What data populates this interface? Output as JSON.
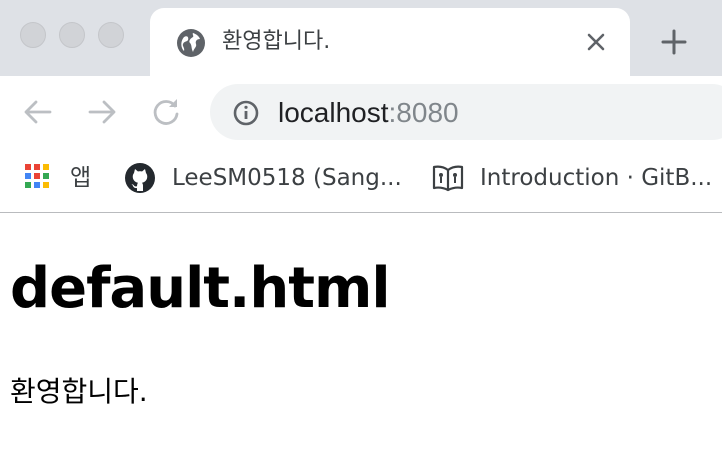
{
  "browser": {
    "tab": {
      "title": "환영합니다.",
      "favicon_icon": "globe-icon",
      "close_icon": "close-icon"
    },
    "new_tab_icon": "plus-icon",
    "toolbar": {
      "back_icon": "arrow-left-icon",
      "forward_icon": "arrow-right-icon",
      "reload_icon": "reload-icon",
      "info_icon": "info-icon",
      "url_host": "localhost",
      "url_port": ":8080"
    },
    "bookmarks": [
      {
        "label": "앱",
        "icon": "apps-grid-icon"
      },
      {
        "label": "LeeSM0518 (Sang...",
        "icon": "github-icon"
      },
      {
        "label": "Introduction · GitB...",
        "icon": "book-icon"
      }
    ]
  },
  "page": {
    "heading": "default.html",
    "paragraph": "환영합니다."
  },
  "colors": {
    "tabstrip_bg": "#dee1e6",
    "omnibox_bg": "#f1f3f4",
    "port_text": "#80868b"
  }
}
